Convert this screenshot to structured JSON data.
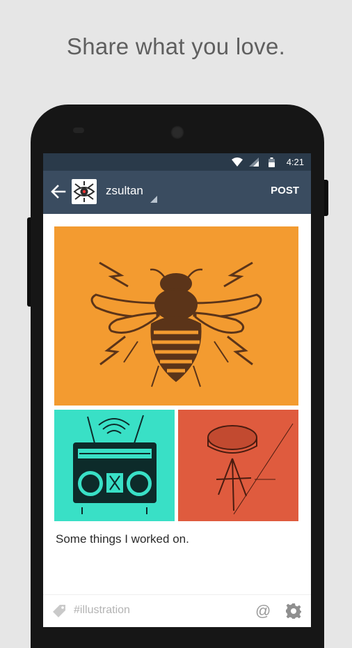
{
  "promo": {
    "tagline": "Share what you love."
  },
  "status_bar": {
    "time": "4:21",
    "icons": [
      "wifi-icon",
      "signal-icon",
      "battery-icon"
    ]
  },
  "app_bar": {
    "back_icon": "arrow-left-icon",
    "avatar_icon": "eye-logo-icon",
    "username": "zsultan",
    "post_label": "POST"
  },
  "post": {
    "images": [
      {
        "name": "bee-illustration",
        "bg": "#f39b30"
      },
      {
        "name": "boombox-illustration",
        "bg": "#39e0c6"
      },
      {
        "name": "stool-illustration",
        "bg": "#df5b3e"
      }
    ],
    "caption": "Some things I worked on."
  },
  "bottom_bar": {
    "tag_icon": "tag-icon",
    "tags_text": "#illustration",
    "mention_symbol": "@",
    "settings_icon": "gear-icon"
  },
  "colors": {
    "app_bar": "#3a4c60",
    "status_bar": "#2a3a4a",
    "background": "#e6e6e6"
  }
}
